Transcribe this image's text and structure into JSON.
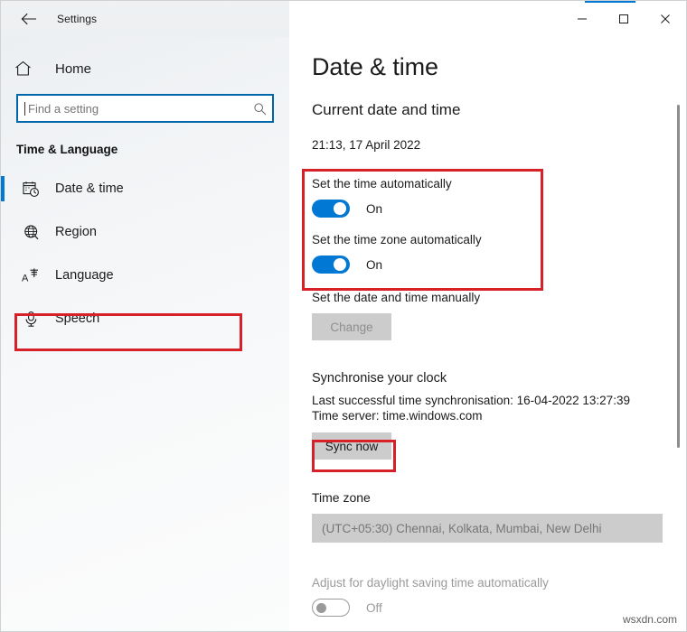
{
  "window": {
    "title": "Settings",
    "back_icon": "back-arrow-icon",
    "minimize_label": "─",
    "maximize_label": "□",
    "close_label": "✕",
    "accent_color": "#0078d4"
  },
  "sidebar": {
    "home_label": "Home",
    "home_icon": "home-icon",
    "search": {
      "placeholder": "Find a setting",
      "value": "",
      "icon": "search-icon"
    },
    "category_title": "Time & Language",
    "items": [
      {
        "label": "Date & time",
        "icon": "calendar-clock-icon",
        "selected": true
      },
      {
        "label": "Region",
        "icon": "globe-icon",
        "selected": false
      },
      {
        "label": "Language",
        "icon": "language-icon",
        "selected": false
      },
      {
        "label": "Speech",
        "icon": "microphone-icon",
        "selected": false
      }
    ]
  },
  "main": {
    "page_title": "Date & time",
    "current_section_title": "Current date and time",
    "current_datetime": "21:13, 17 April 2022",
    "set_time_auto": {
      "label": "Set the time automatically",
      "state": "On",
      "on": true
    },
    "set_timezone_auto": {
      "label": "Set the time zone automatically",
      "state": "On",
      "on": true
    },
    "manual": {
      "label": "Set the date and time manually",
      "button_label": "Change",
      "disabled": true
    },
    "sync": {
      "heading": "Synchronise your clock",
      "last_sync": "Last successful time synchronisation: 16-04-2022 13:27:39",
      "time_server": "Time server: time.windows.com",
      "button_label": "Sync now"
    },
    "timezone": {
      "heading": "Time zone",
      "selected": "(UTC+05:30) Chennai, Kolkata, Mumbai, New Delhi"
    },
    "daylight": {
      "label": "Adjust for daylight saving time automatically",
      "state": "Off",
      "on": false
    }
  },
  "annotations": {
    "highlight_color": "#d62128"
  },
  "watermark": "wsxdn.com"
}
